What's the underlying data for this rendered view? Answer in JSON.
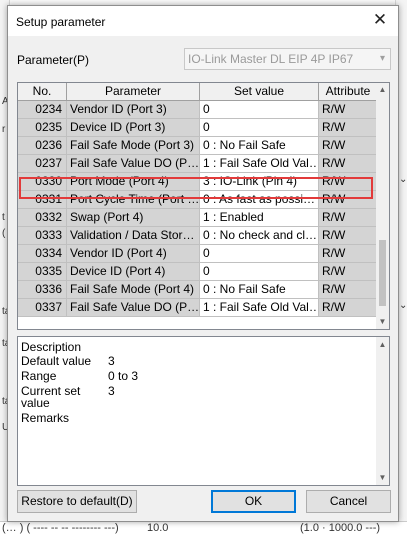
{
  "background": {
    "bottom_left_text": "(… ) ( ---- -- -- -------- ---)",
    "bottom_mid_text": "10.0",
    "bottom_right_text": "(1.0 · 1000.0 ---)"
  },
  "dialog": {
    "title": "Setup parameter",
    "close_icon": "close-icon"
  },
  "parameter_selector": {
    "label": "Parameter(P)",
    "selected": "IO-Link Master DL EIP 4P IP67"
  },
  "grid": {
    "columns": [
      "No.",
      "Parameter",
      "Set value",
      "Attribute"
    ],
    "rows": [
      {
        "no": "0234",
        "parameter": "Vendor ID (Port 3)",
        "value": "0",
        "attr": "R/W"
      },
      {
        "no": "0235",
        "parameter": "Device ID (Port 3)",
        "value": "0",
        "attr": "R/W"
      },
      {
        "no": "0236",
        "parameter": "Fail Safe Mode (Port 3)",
        "value": "0 : No Fail Safe",
        "attr": "R/W"
      },
      {
        "no": "0237",
        "parameter": "Fail Safe Value DO (P…",
        "value": "1 : Fail Safe Old Val…",
        "attr": "R/W"
      },
      {
        "no": "0330",
        "parameter": "Port Mode (Port 4)",
        "value": "3 : IO-Link (Pin 4)",
        "attr": "R/W"
      },
      {
        "no": "0331",
        "parameter": "Port Cycle Time (Port …",
        "value": "0 : As fast as possi…",
        "attr": "R/W"
      },
      {
        "no": "0332",
        "parameter": "Swap (Port 4)",
        "value": "1 : Enabled",
        "attr": "R/W"
      },
      {
        "no": "0333",
        "parameter": "Validation / Data Stor…",
        "value": "0 : No check and cl…",
        "attr": "R/W"
      },
      {
        "no": "0334",
        "parameter": "Vendor ID (Port 4)",
        "value": "0",
        "attr": "R/W"
      },
      {
        "no": "0335",
        "parameter": "Device ID (Port 4)",
        "value": "0",
        "attr": "R/W"
      },
      {
        "no": "0336",
        "parameter": "Fail Safe Mode (Port 4)",
        "value": "0 : No Fail Safe",
        "attr": "R/W"
      },
      {
        "no": "0337",
        "parameter": "Fail Safe Value DO (P…",
        "value": "1 : Fail Safe Old Val…",
        "attr": "R/W"
      }
    ],
    "highlight_color": "#e23a3a"
  },
  "description": {
    "description_label": "Description",
    "default_label": "Default value",
    "default_value": "3",
    "range_label": "Range",
    "range_value": "0 to 3",
    "current_label_1": "Current set",
    "current_label_2": "value",
    "current_value": "3",
    "remarks_label": "Remarks"
  },
  "buttons": {
    "restore": "Restore to default(D)",
    "ok": "OK",
    "cancel": "Cancel"
  },
  "colors": {
    "accent": "#0078d7",
    "readonly_cell": "#d4d4d4"
  }
}
